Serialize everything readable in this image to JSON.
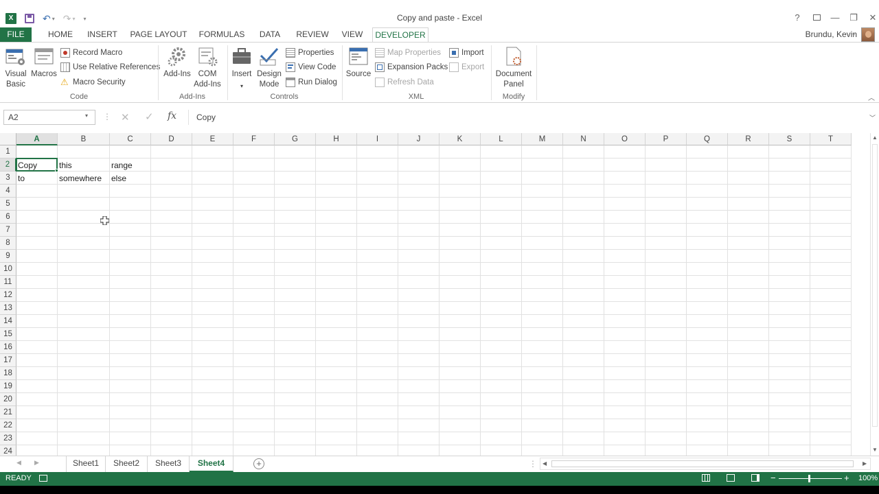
{
  "window": {
    "title": "Copy and paste - Excel",
    "user": "Brundu, Kevin",
    "help": "?",
    "minimize": "—",
    "restore": "❐",
    "close": "✕"
  },
  "tabs": [
    "FILE",
    "HOME",
    "INSERT",
    "PAGE LAYOUT",
    "FORMULAS",
    "DATA",
    "REVIEW",
    "VIEW",
    "DEVELOPER"
  ],
  "ribbon": {
    "code": {
      "visual_basic": [
        "Visual",
        "Basic"
      ],
      "macros": "Macros",
      "record_macro": "Record Macro",
      "use_relative": "Use Relative References",
      "macro_security": "Macro Security",
      "label": "Code"
    },
    "addins": {
      "addins": "Add-Ins",
      "com_addins": [
        "COM",
        "Add-Ins"
      ],
      "label": "Add-Ins"
    },
    "controls": {
      "insert": "Insert",
      "design_mode": [
        "Design",
        "Mode"
      ],
      "properties": "Properties",
      "view_code": "View Code",
      "run_dialog": "Run Dialog",
      "label": "Controls"
    },
    "xml": {
      "source": "Source",
      "map_properties": "Map Properties",
      "expansion_packs": "Expansion Packs",
      "refresh_data": "Refresh Data",
      "import": "Import",
      "export": "Export",
      "label": "XML"
    },
    "modify": {
      "document_panel": [
        "Document",
        "Panel"
      ],
      "label": "Modify"
    }
  },
  "formula_bar": {
    "name_box": "A2",
    "fx": "fx",
    "value": "Copy"
  },
  "columns": [
    "A",
    "B",
    "C",
    "D",
    "E",
    "F",
    "G",
    "H",
    "I",
    "J",
    "K",
    "L",
    "M",
    "N",
    "O",
    "P",
    "Q",
    "R",
    "S",
    "T"
  ],
  "rows": [
    "1",
    "2",
    "3",
    "4",
    "5",
    "6",
    "7",
    "8",
    "9",
    "10",
    "11",
    "12",
    "13",
    "14",
    "15",
    "16",
    "17",
    "18",
    "19",
    "20",
    "21",
    "22",
    "23",
    "24"
  ],
  "cells": {
    "A2": "Copy",
    "B2": "this",
    "C2": "range",
    "A3": "to",
    "B3": "somewhere",
    "C3": "else"
  },
  "sheets": [
    "Sheet1",
    "Sheet2",
    "Sheet3",
    "Sheet4"
  ],
  "active_sheet": "Sheet4",
  "status": {
    "ready": "READY",
    "zoom": "100%"
  },
  "colors": {
    "accent": "#217346"
  }
}
